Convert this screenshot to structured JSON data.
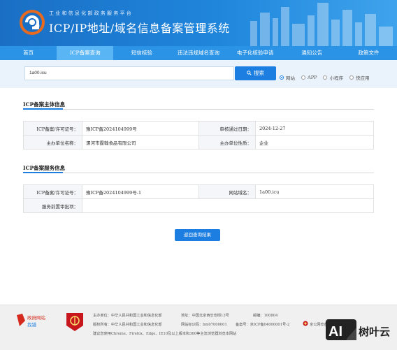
{
  "header": {
    "subtitle": "工  业  和  信  息  化  部  政  务  服  务  平  台",
    "title": "ICP/IP地址/域名信息备案管理系统"
  },
  "nav": [
    {
      "label": "首页"
    },
    {
      "label": "ICP备案查询"
    },
    {
      "label": "短信核验"
    },
    {
      "label": "违法违规域名查询"
    },
    {
      "label": "电子化核验申请"
    },
    {
      "label": "通知公告"
    },
    {
      "label": "政策文件"
    }
  ],
  "search": {
    "value": "1a00.icu",
    "button_label": "搜索",
    "options": [
      {
        "label": "网站",
        "selected": true
      },
      {
        "label": "APP",
        "selected": false
      },
      {
        "label": "小程序",
        "selected": false
      },
      {
        "label": "快应用",
        "selected": false
      }
    ]
  },
  "subject": {
    "title": "ICP备案主体信息",
    "license_label": "ICP备案/许可证号：",
    "license_value": "豫ICP备2024104999号",
    "approve_date_label": "审核通过日期：",
    "approve_date_value": "2024-12-27",
    "org_name_label": "主办单位名称：",
    "org_name_value": "漯河市霆翰食品有限公司",
    "org_type_label": "主办单位性质：",
    "org_type_value": "企业"
  },
  "service": {
    "title": "ICP备案服务信息",
    "service_license_label": "ICP备案/许可证号：",
    "service_license_value": "豫ICP备2024104999号-1",
    "domain_label": "网站域名：",
    "domain_value": "1a00.icu",
    "preapproval_label": "服务前置审批项：",
    "preapproval_value": ""
  },
  "back_button": "返回查询结果",
  "footer": {
    "badge_text_1": "政府网站",
    "badge_text_2": "找错",
    "host": "主办单位：中华人民共和国工业和信息化部",
    "address": "地址：中国北京西长安街13号",
    "postcode": "邮编：100804",
    "copyright": "版权所有：中华人民共和国工业和信息化部",
    "site_id": "网站标识码：bm07000001",
    "icp": "备案号：京ICP备04000001号-2",
    "police": "京公网安备 110102000",
    "browser_tip": "建议您使用Chrome、Firefox、Edge、IE10及以上版本和360等主流浏览器浏览本网站"
  },
  "watermark": {
    "text": "树叶云",
    "badge": "AI"
  },
  "colors": {
    "primary": "#1c7ee0",
    "nav": "#2a93e6",
    "nav_active": "#5ab5f5",
    "header_start": "#1a6fc4"
  }
}
